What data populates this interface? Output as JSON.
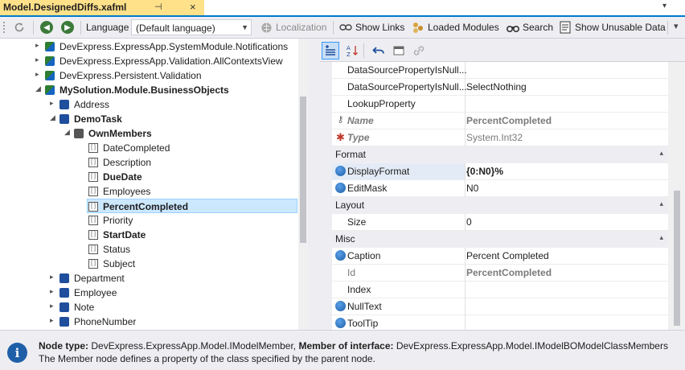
{
  "tab": {
    "title": "Model.DesignedDiffs.xafml",
    "pin": "⊣",
    "close": "×",
    "dropdown": "▾"
  },
  "toolbar": {
    "language_label": "Language",
    "language_value": "(Default language)",
    "localization": "Localization",
    "show_links": "Show Links",
    "loaded_modules": "Loaded Modules",
    "search": "Search",
    "show_unusable": "Show Unusable Data"
  },
  "tree": {
    "items": [
      {
        "text": "DevExpress.ExpressApp.SystemModule.Notifications",
        "level": 0,
        "icon": "ns",
        "expander": "▸",
        "bold": false
      },
      {
        "text": "DevExpress.ExpressApp.Validation.AllContextsView",
        "level": 0,
        "icon": "ns",
        "expander": "▸",
        "bold": false
      },
      {
        "text": "DevExpress.Persistent.Validation",
        "level": 0,
        "icon": "ns",
        "expander": "▸",
        "bold": false
      },
      {
        "text": "MySolution.Module.BusinessObjects",
        "level": 0,
        "icon": "ns",
        "expander": "◢",
        "bold": true
      },
      {
        "text": "Address",
        "level": 1,
        "icon": "cls",
        "expander": "▸",
        "bold": false
      },
      {
        "text": "DemoTask",
        "level": 1,
        "icon": "cls",
        "expander": "◢",
        "bold": true
      },
      {
        "text": "OwnMembers",
        "level": 2,
        "icon": "grp",
        "expander": "◢",
        "bold": true
      },
      {
        "text": "DateCompleted",
        "level": 3,
        "icon": "mem",
        "expander": "",
        "bold": false
      },
      {
        "text": "Description",
        "level": 3,
        "icon": "mem",
        "expander": "",
        "bold": false
      },
      {
        "text": "DueDate",
        "level": 3,
        "icon": "mem",
        "expander": "",
        "bold": true
      },
      {
        "text": "Employees",
        "level": 3,
        "icon": "mem",
        "expander": "",
        "bold": false
      },
      {
        "text": "PercentCompleted",
        "level": 3,
        "icon": "mem",
        "expander": "",
        "bold": true,
        "selected": true
      },
      {
        "text": "Priority",
        "level": 3,
        "icon": "mem",
        "expander": "",
        "bold": false
      },
      {
        "text": "StartDate",
        "level": 3,
        "icon": "mem",
        "expander": "",
        "bold": true
      },
      {
        "text": "Status",
        "level": 3,
        "icon": "mem",
        "expander": "",
        "bold": false
      },
      {
        "text": "Subject",
        "level": 3,
        "icon": "mem",
        "expander": "",
        "bold": false
      },
      {
        "text": "Department",
        "level": 1,
        "icon": "cls",
        "expander": "▸",
        "bold": false
      },
      {
        "text": "Employee",
        "level": 1,
        "icon": "cls",
        "expander": "▸",
        "bold": false
      },
      {
        "text": "Note",
        "level": 1,
        "icon": "cls",
        "expander": "▸",
        "bold": false
      },
      {
        "text": "PhoneNumber",
        "level": 1,
        "icon": "cls",
        "expander": "▸",
        "bold": false
      }
    ]
  },
  "properties": {
    "rows": [
      {
        "kind": "prop",
        "name": "DataSourcePropertyIsNull...",
        "value": "",
        "icon": ""
      },
      {
        "kind": "prop",
        "name": "DataSourcePropertyIsNull...",
        "value": "SelectNothing",
        "icon": ""
      },
      {
        "kind": "prop",
        "name": "LookupProperty",
        "value": "",
        "icon": ""
      },
      {
        "kind": "prop",
        "name": "Name",
        "value": "PercentCompleted",
        "icon": "key",
        "style": "ro-bold"
      },
      {
        "kind": "prop",
        "name": "Type",
        "value": "System.Int32",
        "icon": "star",
        "style": "ro"
      },
      {
        "kind": "cat",
        "name": "Format",
        "arrow": "▴"
      },
      {
        "kind": "prop",
        "name": "DisplayFormat",
        "value": "{0:N0}%",
        "icon": "globe",
        "style": "hl-bold"
      },
      {
        "kind": "prop",
        "name": "EditMask",
        "value": "N0",
        "icon": "globe"
      },
      {
        "kind": "cat",
        "name": "Layout",
        "arrow": "▴"
      },
      {
        "kind": "prop",
        "name": "Size",
        "value": "0",
        "icon": ""
      },
      {
        "kind": "cat",
        "name": "Misc",
        "arrow": "▴"
      },
      {
        "kind": "prop",
        "name": "Caption",
        "value": "Percent Completed",
        "icon": "globe"
      },
      {
        "kind": "prop",
        "name": "Id",
        "value": "PercentCompleted",
        "icon": "",
        "style": "ro-id"
      },
      {
        "kind": "prop",
        "name": "Index",
        "value": "",
        "icon": ""
      },
      {
        "kind": "prop",
        "name": "NullText",
        "value": "",
        "icon": "globe"
      },
      {
        "kind": "prop",
        "name": "ToolTip",
        "value": "",
        "icon": "globe"
      }
    ]
  },
  "description": {
    "label1": "Node type:",
    "value1": " DevExpress.ExpressApp.Model.IModelMember, ",
    "label2": "Member of interface:",
    "value2": " DevExpress.ExpressApp.Model.IModelBOModelClassMembers",
    "line2": "The Member node defines a property of the class specified by the parent node."
  },
  "colors": {
    "accent": "#007acc",
    "tab": "#ffe18a",
    "selection": "#cce8ff"
  }
}
